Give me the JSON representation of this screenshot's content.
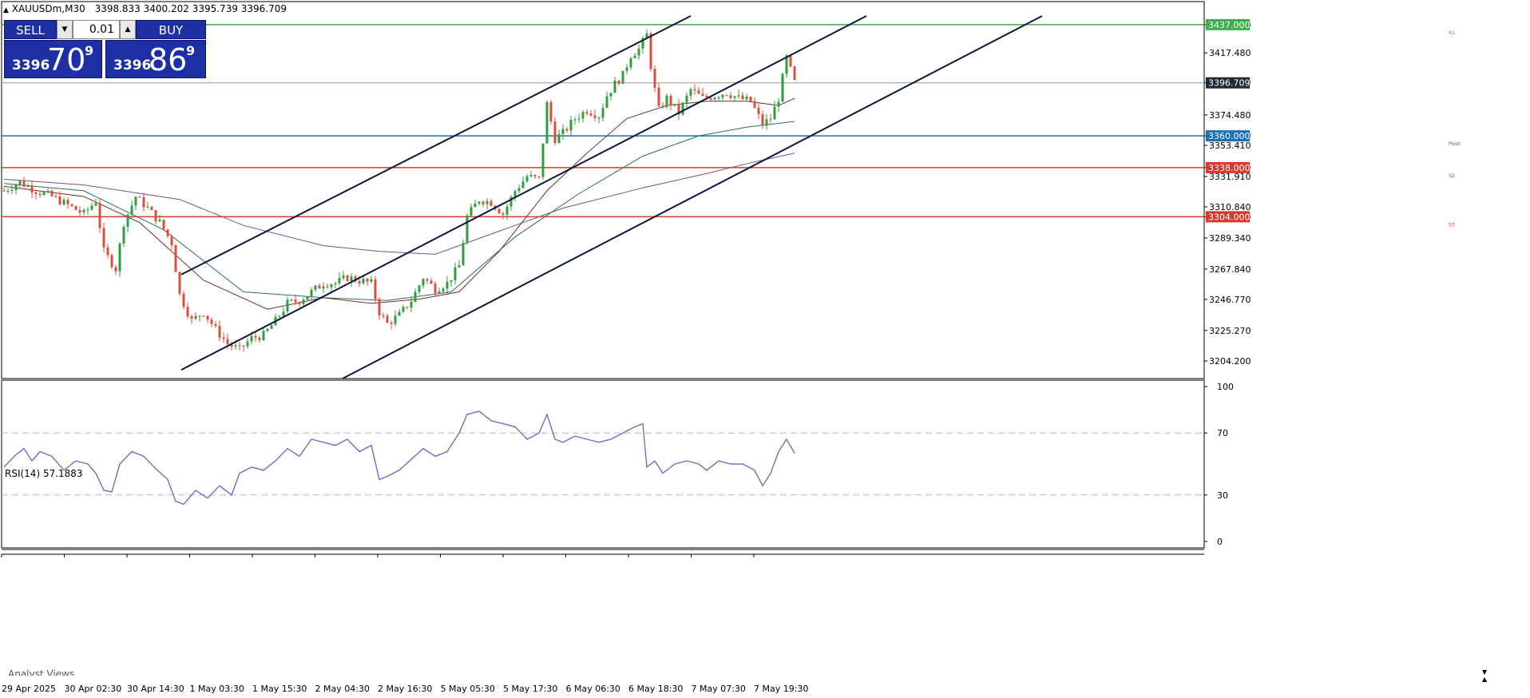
{
  "header": {
    "symbol": "XAUUSDm,M30",
    "ohlc": "3398.833 3400.202 3395.739 3396.709"
  },
  "trade_panel": {
    "sell_label": "SELL",
    "buy_label": "BUY",
    "lot": "0.01",
    "sell_prefix": "3396",
    "sell_big": "70",
    "sell_sup": "9",
    "buy_prefix": "3396",
    "buy_big": "86",
    "buy_sup": "9"
  },
  "chart_data": {
    "type": "line",
    "title": "XAUUSDm,M30",
    "ylim": [
      3192,
      3443
    ],
    "y_ticks": [
      "3437.000",
      "3417.480",
      "3396.709",
      "3374.480",
      "3360.000",
      "3353.410",
      "3338.000",
      "3331.910",
      "3310.840",
      "3304.000",
      "3289.340",
      "3267.840",
      "3246.770",
      "3225.270",
      "3204.200"
    ],
    "x_ticks": [
      "29 Apr 2025",
      "30 Apr 02:30",
      "30 Apr 14:30",
      "1 May 03:30",
      "1 May 15:30",
      "2 May 04:30",
      "2 May 16:30",
      "5 May 05:30",
      "5 May 17:30",
      "6 May 06:30",
      "6 May 18:30",
      "7 May 07:30",
      "7 May 19:30"
    ],
    "levels": [
      {
        "name": "R1",
        "value": 3437.0,
        "label": "3437.000",
        "color": "#3cb04a"
      },
      {
        "name": "Pivot",
        "value": 3360.0,
        "label": "3360.000",
        "color": "#1a6fb5"
      },
      {
        "name": "S2",
        "value": 3338.0,
        "label": "3338.000",
        "color": "#d63a2e"
      },
      {
        "name": "S3",
        "value": 3304.0,
        "label": "3304.000",
        "color": "#d63a2e"
      }
    ],
    "current_price": {
      "value": 3396.709,
      "label": "3396.709"
    },
    "price_path": [
      [
        0,
        3322
      ],
      [
        20,
        3328
      ],
      [
        40,
        3322
      ],
      [
        60,
        3318
      ],
      [
        80,
        3312
      ],
      [
        100,
        3306
      ],
      [
        115,
        3315
      ],
      [
        125,
        3280
      ],
      [
        140,
        3268
      ],
      [
        150,
        3300
      ],
      [
        165,
        3318
      ],
      [
        180,
        3310
      ],
      [
        195,
        3300
      ],
      [
        210,
        3286
      ],
      [
        220,
        3250
      ],
      [
        235,
        3232
      ],
      [
        250,
        3238
      ],
      [
        265,
        3226
      ],
      [
        280,
        3216
      ],
      [
        295,
        3212
      ],
      [
        310,
        3220
      ],
      [
        325,
        3222
      ],
      [
        340,
        3232
      ],
      [
        355,
        3244
      ],
      [
        370,
        3246
      ],
      [
        385,
        3252
      ],
      [
        400,
        3258
      ],
      [
        415,
        3258
      ],
      [
        430,
        3262
      ],
      [
        445,
        3260
      ],
      [
        460,
        3258
      ],
      [
        470,
        3238
      ],
      [
        480,
        3230
      ],
      [
        495,
        3236
      ],
      [
        510,
        3246
      ],
      [
        525,
        3262
      ],
      [
        540,
        3254
      ],
      [
        555,
        3258
      ],
      [
        570,
        3270
      ],
      [
        580,
        3304
      ],
      [
        595,
        3316
      ],
      [
        610,
        3314
      ],
      [
        625,
        3306
      ],
      [
        640,
        3322
      ],
      [
        655,
        3332
      ],
      [
        670,
        3330
      ],
      [
        680,
        3382
      ],
      [
        690,
        3358
      ],
      [
        700,
        3362
      ],
      [
        715,
        3372
      ],
      [
        730,
        3378
      ],
      [
        745,
        3374
      ],
      [
        755,
        3388
      ],
      [
        765,
        3396
      ],
      [
        775,
        3402
      ],
      [
        785,
        3416
      ],
      [
        795,
        3420
      ],
      [
        805,
        3430
      ],
      [
        812,
        3400
      ],
      [
        820,
        3378
      ],
      [
        830,
        3386
      ],
      [
        845,
        3376
      ],
      [
        860,
        3392
      ],
      [
        875,
        3386
      ],
      [
        890,
        3388
      ],
      [
        905,
        3390
      ],
      [
        920,
        3386
      ],
      [
        935,
        3384
      ],
      [
        950,
        3368
      ],
      [
        960,
        3372
      ],
      [
        970,
        3386
      ],
      [
        980,
        3414
      ],
      [
        990,
        3397
      ]
    ],
    "ma_fast": [
      [
        0,
        3325
      ],
      [
        100,
        3318
      ],
      [
        170,
        3300
      ],
      [
        250,
        3260
      ],
      [
        330,
        3240
      ],
      [
        400,
        3248
      ],
      [
        460,
        3244
      ],
      [
        520,
        3247
      ],
      [
        570,
        3252
      ],
      [
        620,
        3280
      ],
      [
        680,
        3322
      ],
      [
        730,
        3348
      ],
      [
        780,
        3372
      ],
      [
        830,
        3381
      ],
      [
        880,
        3384
      ],
      [
        930,
        3384
      ],
      [
        970,
        3381
      ],
      [
        990,
        3386
      ]
    ],
    "ma_mid": [
      [
        0,
        3327
      ],
      [
        100,
        3322
      ],
      [
        200,
        3295
      ],
      [
        300,
        3252
      ],
      [
        400,
        3248
      ],
      [
        480,
        3246
      ],
      [
        560,
        3252
      ],
      [
        640,
        3290
      ],
      [
        720,
        3320
      ],
      [
        800,
        3346
      ],
      [
        870,
        3360
      ],
      [
        930,
        3366
      ],
      [
        990,
        3370
      ]
    ],
    "ma_slow": [
      [
        0,
        3330
      ],
      [
        100,
        3326
      ],
      [
        220,
        3316
      ],
      [
        300,
        3298
      ],
      [
        400,
        3284
      ],
      [
        470,
        3280
      ],
      [
        540,
        3278
      ],
      [
        620,
        3294
      ],
      [
        700,
        3310
      ],
      [
        800,
        3324
      ],
      [
        880,
        3334
      ],
      [
        940,
        3342
      ],
      [
        990,
        3348
      ]
    ],
    "channel": [
      {
        "x0": 222,
        "y0": 3264,
        "x1": 860,
        "y1": 3443
      },
      {
        "x0": 222,
        "y0": 3198,
        "x1": 1080,
        "y1": 3443
      },
      {
        "x0": 424,
        "y0": 3192,
        "x1": 1300,
        "y1": 3443
      }
    ],
    "rsi": {
      "label": "RSI(14) 57.1883",
      "ylim": [
        0,
        100
      ],
      "ticks": [
        "100",
        "70",
        "30",
        "0"
      ],
      "levels": [
        70,
        30
      ],
      "path": [
        [
          0,
          48
        ],
        [
          15,
          56
        ],
        [
          25,
          60
        ],
        [
          35,
          52
        ],
        [
          45,
          58
        ],
        [
          60,
          55
        ],
        [
          75,
          46
        ],
        [
          90,
          52
        ],
        [
          105,
          50
        ],
        [
          115,
          44
        ],
        [
          125,
          33
        ],
        [
          135,
          32
        ],
        [
          145,
          50
        ],
        [
          160,
          58
        ],
        [
          175,
          55
        ],
        [
          190,
          47
        ],
        [
          205,
          40
        ],
        [
          215,
          26
        ],
        [
          225,
          24
        ],
        [
          240,
          33
        ],
        [
          255,
          28
        ],
        [
          270,
          36
        ],
        [
          285,
          30
        ],
        [
          295,
          44
        ],
        [
          310,
          48
        ],
        [
          325,
          46
        ],
        [
          340,
          52
        ],
        [
          355,
          60
        ],
        [
          370,
          55
        ],
        [
          385,
          66
        ],
        [
          400,
          64
        ],
        [
          415,
          62
        ],
        [
          430,
          66
        ],
        [
          445,
          58
        ],
        [
          460,
          62
        ],
        [
          470,
          40
        ],
        [
          480,
          42
        ],
        [
          495,
          46
        ],
        [
          510,
          53
        ],
        [
          525,
          60
        ],
        [
          540,
          55
        ],
        [
          555,
          58
        ],
        [
          570,
          70
        ],
        [
          580,
          82
        ],
        [
          595,
          84
        ],
        [
          610,
          78
        ],
        [
          625,
          76
        ],
        [
          640,
          74
        ],
        [
          655,
          66
        ],
        [
          670,
          70
        ],
        [
          680,
          82
        ],
        [
          690,
          66
        ],
        [
          700,
          64
        ],
        [
          715,
          68
        ],
        [
          730,
          66
        ],
        [
          745,
          64
        ],
        [
          760,
          66
        ],
        [
          775,
          70
        ],
        [
          790,
          74
        ],
        [
          800,
          76
        ],
        [
          805,
          48
        ],
        [
          815,
          52
        ],
        [
          825,
          44
        ],
        [
          840,
          50
        ],
        [
          855,
          52
        ],
        [
          870,
          50
        ],
        [
          880,
          46
        ],
        [
          895,
          52
        ],
        [
          910,
          50
        ],
        [
          925,
          50
        ],
        [
          940,
          46
        ],
        [
          950,
          36
        ],
        [
          960,
          44
        ],
        [
          970,
          58
        ],
        [
          980,
          66
        ],
        [
          990,
          57
        ]
      ]
    },
    "grid": false
  },
  "footer": {
    "analyst_views": "Analyst Views"
  },
  "colors": {
    "bull": "#2e9e3e",
    "bear": "#d94f3c",
    "ma_fast": "#7b2a2a",
    "ma_mid": "#2d6e5c",
    "ma_slow": "#7a4f86",
    "channel": "#0b1640",
    "rsi": "#7b68c5",
    "panel_blue": "#1d2fa3"
  }
}
